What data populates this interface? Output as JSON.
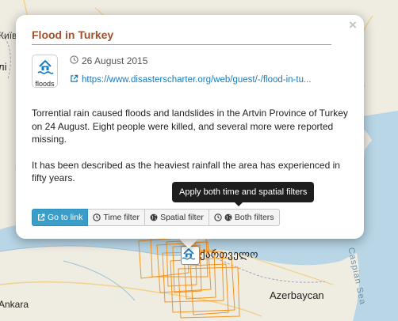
{
  "map": {
    "labels": {
      "kiev": "Київ",
      "left_partial": "лі",
      "georgia": "ქართველო",
      "azerbaijan": "Azerbaycan",
      "ankara": "Ankara",
      "left_small": "l",
      "sea": "Caspian Sea"
    },
    "colors": {
      "land": "#efece2",
      "water": "#b8d6e6",
      "footprint": "#f7931e"
    }
  },
  "popup": {
    "title": "Flood in Turkey",
    "close_glyph": "×",
    "badge": {
      "icon": "flood-house-icon",
      "label": "floods"
    },
    "date": "26 August 2015",
    "link": "https://www.disasterscharter.org/web/guest/-/flood-in-tu...",
    "description": [
      "Torrential rain caused floods and landslides in the Artvin Province of Turkey on 24 August. Eight people were killed, and several more were reported missing.",
      "It has been described as the heaviest rainfall the area has experienced in fifty years."
    ],
    "tooltip": "Apply both time and spatial filters",
    "buttons": {
      "go_to_link": "Go to link",
      "time_filter": "Time filter",
      "spatial_filter": "Spatial filter",
      "both_filters": "Both filters"
    },
    "colors": {
      "title": "#a0522d",
      "link": "#1a7bbf",
      "primary_button": "#3b9ec9"
    }
  }
}
